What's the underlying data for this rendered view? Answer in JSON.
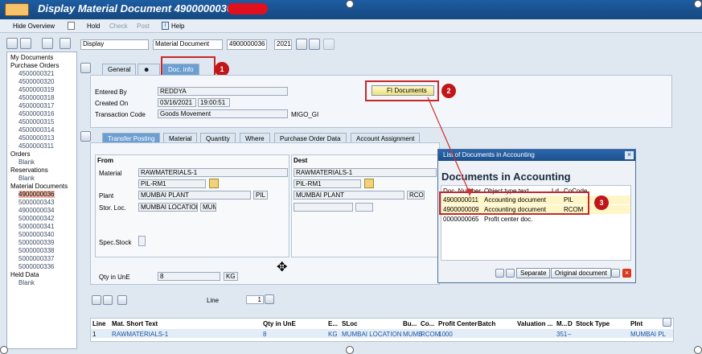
{
  "window": {
    "title": "Display Material Document 4900000036"
  },
  "appbar": {
    "hide_overview": "Hide Overview",
    "hold": "Hold",
    "check": "Check",
    "post": "Post",
    "help": "Help"
  },
  "controls": {
    "action": "Display",
    "doc_type": "Material Document",
    "doc_number": "4900000036",
    "year": "2021"
  },
  "tree": {
    "my_documents": "My Documents",
    "purchase_orders": "Purchase Orders",
    "po_items": [
      "4500000321",
      "4500000320",
      "4500000319",
      "4500000318",
      "4500000317",
      "4500000316",
      "4500000315",
      "4500000314",
      "4500000313",
      "4500000311"
    ],
    "orders": "Orders",
    "orders_items": [
      "Blank"
    ],
    "reservations": "Reservations",
    "reservations_items": [
      "Blank"
    ],
    "material_documents": "Material Documents",
    "md_items": [
      "4900000036",
      "5000000343",
      "4900000034",
      "5000000342",
      "5000000341",
      "5000000340",
      "5000000339",
      "5000000338",
      "5000000337",
      "5000000336"
    ],
    "held_data": "Held Data",
    "held_items": [
      "Blank"
    ]
  },
  "header_tabs": {
    "general": "General",
    "partner_icon": "",
    "doc_info": "Doc. info"
  },
  "doc_info": {
    "entered_by_label": "Entered By",
    "entered_by": "REDDYA",
    "created_on_label": "Created On",
    "created_on": "03/16/2021",
    "created_time": "19:00:51",
    "tcode_label": "Transaction Code",
    "tcode_text": "Goods Movement",
    "tcode": "MIGO_GI",
    "fi_button": "FI Documents"
  },
  "item_tabs": [
    "Transfer Posting",
    "Material",
    "Quantity",
    "Where",
    "Purchase Order Data",
    "Account Assignment"
  ],
  "from": {
    "title": "From",
    "material_label": "Material",
    "material": "RAWMATERIALS-1",
    "material2": "PIL-RM1",
    "plant_label": "Plant",
    "plant": "MUMBAI PLANT",
    "plant_code": "PIL",
    "sloc_label": "Stor. Loc.",
    "sloc": "MUMBAI LOCATION",
    "sloc_code": "MUM",
    "spec_stock_label": "Spec.Stock",
    "qty_label": "Qty in UnE",
    "qty": "8",
    "uom": "KG"
  },
  "dest": {
    "title": "Dest",
    "material": "RAWMATERIALS-1",
    "material2": "PIL-RM1",
    "plant": "MUMBAI PLANT",
    "plant_code": "RCOM"
  },
  "line": {
    "label": "Line",
    "value": "1"
  },
  "table": {
    "headers": [
      "Line",
      "Mat. Short Text",
      "Qty in UnE",
      "E...",
      "SLoc",
      "Bu...",
      "Co...",
      "Profit Center",
      "Batch",
      "Valuation ...",
      "M...",
      "D",
      "Stock Type",
      "Plnt"
    ],
    "row": [
      "1",
      "RAWMATERIALS-1",
      "8",
      "KG",
      "MUMBAI LOCATION",
      "MUMB",
      "RCOM",
      "1000",
      "",
      "",
      "351",
      "–",
      "",
      "MUMBAI PL"
    ]
  },
  "popup": {
    "title": "List of Documents in Accounting",
    "heading": "Documents in Accounting",
    "headers": [
      "Doc. Number",
      "Object type text",
      "Ld",
      "CoCode"
    ],
    "rows": [
      [
        "4900000011",
        "Accounting document",
        "",
        "PIL"
      ],
      [
        "4900000009",
        "Accounting document",
        "",
        "RCOM"
      ],
      [
        "0000000065",
        "Profit center doc.",
        "",
        ""
      ]
    ],
    "btn_separate": "Separate",
    "btn_original": "Original document"
  },
  "badges": [
    "1",
    "2",
    "3"
  ]
}
